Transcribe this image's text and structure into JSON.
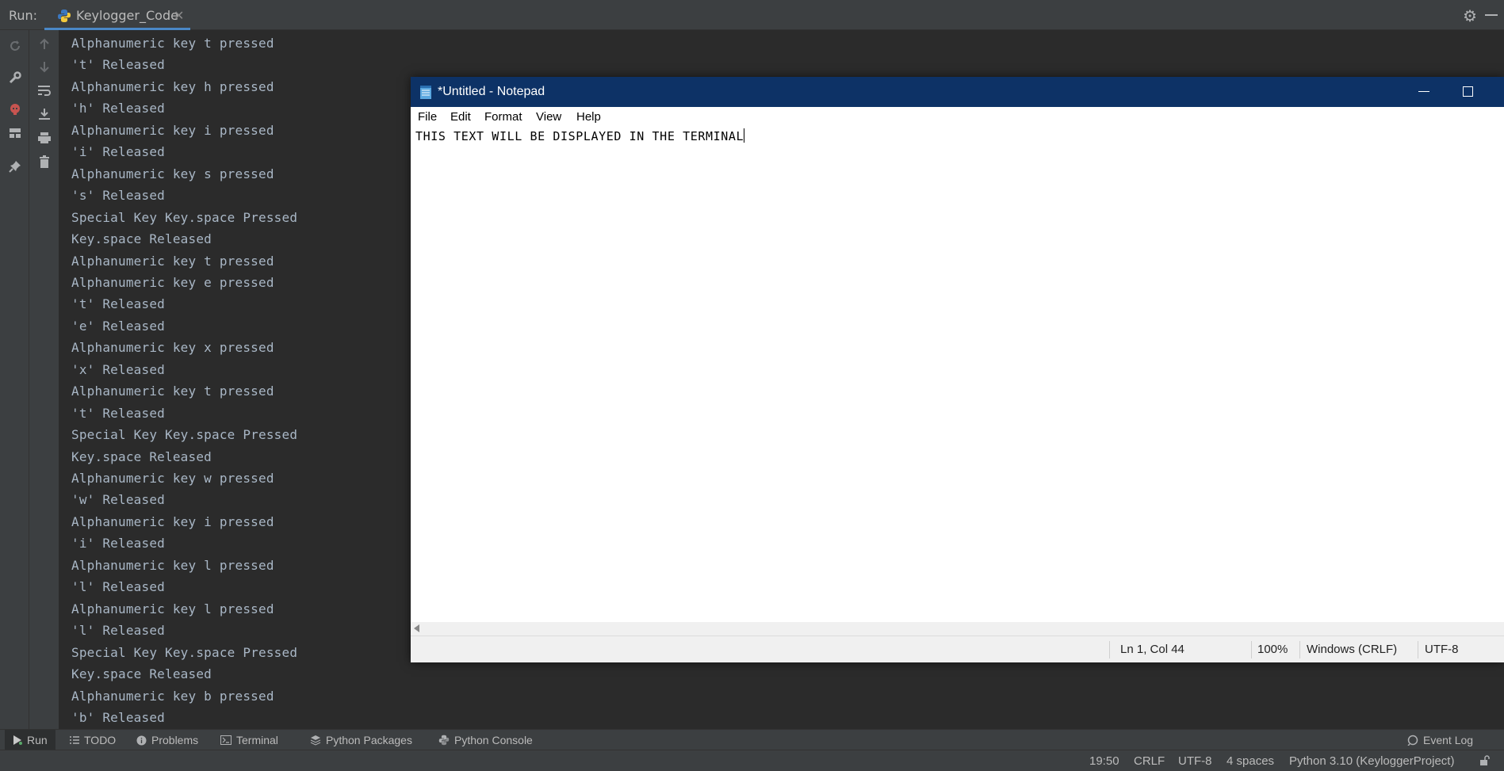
{
  "run_panel": {
    "label": "Run:",
    "tab_name": "Keylogger_Code",
    "icons": [
      "python-icon",
      "close-icon",
      "gear-icon",
      "minimize-icon"
    ]
  },
  "gutter_icons": [
    "rerun-icon",
    "wrench-icon",
    "stop-icon",
    "layout-icon",
    "pin-icon",
    "arrow-up-icon",
    "arrow-down-icon",
    "soft-wrap-icon",
    "scroll-to-end-icon",
    "print-icon",
    "trash-icon"
  ],
  "console_lines": [
    "Alphanumeric key t pressed",
    "'t' Released",
    "Alphanumeric key h pressed",
    "'h' Released",
    "Alphanumeric key i pressed",
    "'i' Released",
    "Alphanumeric key s pressed",
    "'s' Released",
    "Special Key Key.space Pressed",
    "Key.space Released",
    "Alphanumeric key t pressed",
    "Alphanumeric key e pressed",
    "'t' Released",
    "'e' Released",
    "Alphanumeric key x pressed",
    "'x' Released",
    "Alphanumeric key t pressed",
    "'t' Released",
    "Special Key Key.space Pressed",
    "Key.space Released",
    "Alphanumeric key w pressed",
    "'w' Released",
    "Alphanumeric key i pressed",
    "'i' Released",
    "Alphanumeric key l pressed",
    "'l' Released",
    "Alphanumeric key l pressed",
    "'l' Released",
    "Special Key Key.space Pressed",
    "Key.space Released",
    "Alphanumeric key b pressed",
    "'b' Released"
  ],
  "notepad": {
    "title": "*Untitled - Notepad",
    "menu": [
      "File",
      "Edit",
      "Format",
      "View",
      "Help"
    ],
    "content": "THIS TEXT WILL BE DISPLAYED IN THE TERMINAL",
    "status": {
      "position": "Ln 1, Col 44",
      "zoom": "100%",
      "line_ending": "Windows (CRLF)",
      "encoding": "UTF-8"
    }
  },
  "bottom_tabs": [
    {
      "label": "Run",
      "icon": "play-icon"
    },
    {
      "label": "TODO",
      "icon": "list-icon"
    },
    {
      "label": "Problems",
      "icon": "info-icon"
    },
    {
      "label": "Terminal",
      "icon": "terminal-icon"
    },
    {
      "label": "Python Packages",
      "icon": "layers-icon"
    },
    {
      "label": "Python Console",
      "icon": "python-icon"
    }
  ],
  "event_log": "Event Log",
  "status_bar": {
    "position": "19:50",
    "line_separator": "CRLF",
    "encoding": "UTF-8",
    "indent": "4 spaces",
    "interpreter": "Python 3.10 (KeyloggerProject)"
  },
  "colors": {
    "ide_bg": "#2b2b2b",
    "panel_bg": "#3c3f41",
    "console_text": "#a9b7c6",
    "notepad_titlebar": "#0d3266",
    "accent": "#4a88c7"
  }
}
